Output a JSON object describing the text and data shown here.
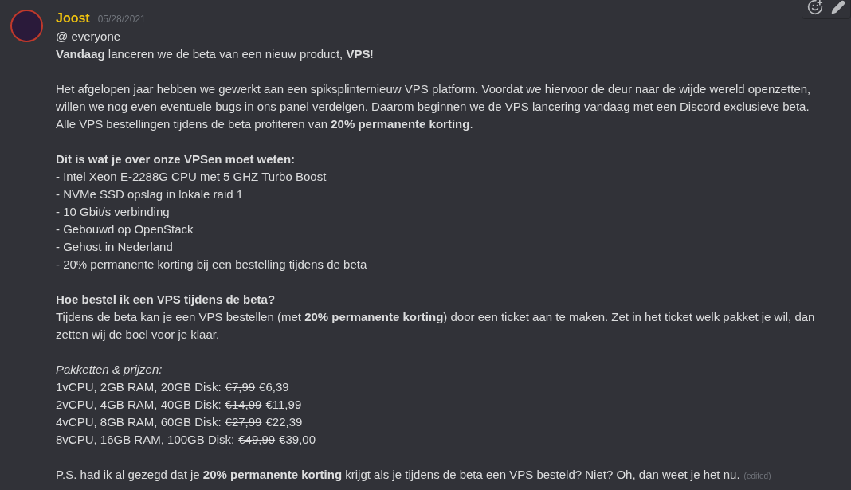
{
  "message": {
    "author": "Joost",
    "timestamp": "05/28/2021",
    "paragraphs": [
      [
        {
          "kind": "text",
          "text": "@ everyone"
        },
        {
          "kind": "text",
          "text": "**Vandaag** lanceren we de beta van een nieuw product, **VPS**!"
        }
      ],
      [
        {
          "kind": "text",
          "text": "Het afgelopen jaar hebben we gewerkt aan een spiksplinternieuw VPS platform. Voordat we hiervoor de deur naar de wijde wereld openzetten, willen we nog even eventuele bugs in ons panel verdelgen. Daarom beginnen we de VPS lancering vandaag met een Discord exclusieve beta."
        },
        {
          "kind": "text",
          "text": "Alle VPS bestellingen tijdens de beta profiteren van **20% permanente korting**."
        }
      ],
      [
        {
          "kind": "heading",
          "text": "Dit is wat je over onze VPSen moet weten:"
        },
        {
          "kind": "text",
          "text": "- Intel Xeon E-2288G CPU met 5 GHZ Turbo Boost"
        },
        {
          "kind": "text",
          "text": "- NVMe SSD opslag in lokale raid 1"
        },
        {
          "kind": "text",
          "text": "- 10 Gbit/s verbinding"
        },
        {
          "kind": "text",
          "text": "- Gebouwd op OpenStack"
        },
        {
          "kind": "text",
          "text": "- Gehost in Nederland"
        },
        {
          "kind": "text",
          "text": "- 20% permanente korting bij een bestelling tijdens de beta"
        }
      ],
      [
        {
          "kind": "heading",
          "text": "Hoe bestel ik een VPS tijdens de beta?"
        },
        {
          "kind": "text",
          "text": "Tijdens de beta kan je een VPS bestellen (met **20% permanente korting**) door een ticket aan te maken. Zet in het ticket welk pakket je wil, dan zetten wij de boel voor je klaar."
        }
      ],
      [
        {
          "kind": "italic",
          "text": "Pakketten & prijzen:"
        },
        {
          "kind": "price",
          "spec": "1vCPU, 2GB RAM, 20GB Disk:",
          "old_price": "€7,99",
          "new_price": "€6,39"
        },
        {
          "kind": "price",
          "spec": "2vCPU, 4GB RAM, 40GB Disk:",
          "old_price": "€14,99",
          "new_price": "€11,99"
        },
        {
          "kind": "price",
          "spec": "4vCPU, 8GB RAM, 60GB Disk:",
          "old_price": "€27,99",
          "new_price": "€22,39"
        },
        {
          "kind": "price",
          "spec": "8vCPU, 16GB RAM, 100GB Disk:",
          "old_price": "€49,99",
          "new_price": "€39,00"
        }
      ],
      [
        {
          "kind": "text",
          "text": "P.S. had ik al gezegd dat je **20% permanente korting** krijgt als je tijdens de beta een VPS besteld? Niet? Oh, dan weet je het nu."
        }
      ]
    ],
    "edited_label": "(edited)"
  }
}
